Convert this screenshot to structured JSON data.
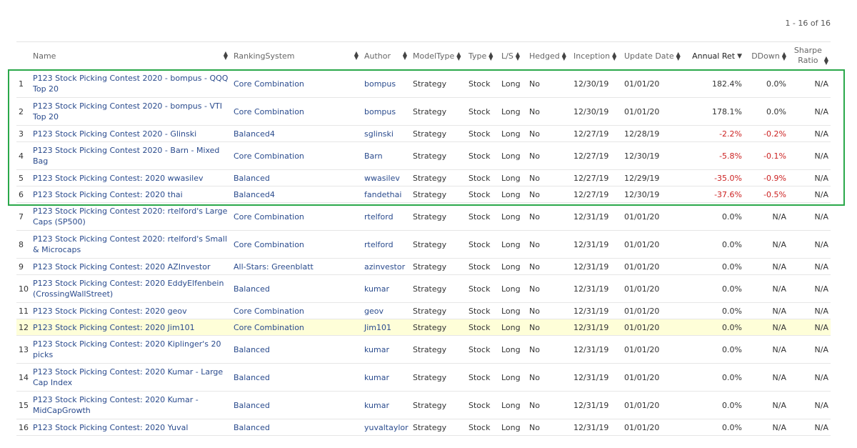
{
  "pager": {
    "text": "1 - 16 of 16"
  },
  "columns": {
    "name": "Name",
    "ranking": "RankingSystem",
    "author": "Author",
    "modeltype": "ModelType",
    "type": "Type",
    "ls": "L/S",
    "hedged": "Hedged",
    "inception": "Inception",
    "update": "Update Date",
    "annual": "Annual Ret",
    "ddown": "DDown",
    "sharpe_line1": "Sharpe",
    "sharpe_line2": "Ratio"
  },
  "rows": [
    {
      "num": "1",
      "name": "P123 Stock Picking Contest 2020 - bompus - QQQ Top 20",
      "ranking": "Core Combination",
      "author": "bompus",
      "modeltype": "Strategy",
      "type": "Stock",
      "ls": "Long",
      "hedged": "No",
      "inception": "12/30/19",
      "update": "01/01/20",
      "annual": "182.4%",
      "ddown": "0.0%",
      "sharpe": "N/A"
    },
    {
      "num": "2",
      "name": "P123 Stock Picking Contest 2020 - bompus - VTI Top 20",
      "ranking": "Core Combination",
      "author": "bompus",
      "modeltype": "Strategy",
      "type": "Stock",
      "ls": "Long",
      "hedged": "No",
      "inception": "12/30/19",
      "update": "01/01/20",
      "annual": "178.1%",
      "ddown": "0.0%",
      "sharpe": "N/A"
    },
    {
      "num": "3",
      "name": "P123 Stock Picking Contest 2020 - Glinski",
      "ranking": "Balanced4",
      "author": "sglinski",
      "modeltype": "Strategy",
      "type": "Stock",
      "ls": "Long",
      "hedged": "No",
      "inception": "12/27/19",
      "update": "12/28/19",
      "annual": "-2.2%",
      "ddown": "-0.2%",
      "sharpe": "N/A"
    },
    {
      "num": "4",
      "name": "P123 Stock Picking Contest 2020 - Barn - Mixed Bag",
      "ranking": "Core Combination",
      "author": "Barn",
      "modeltype": "Strategy",
      "type": "Stock",
      "ls": "Long",
      "hedged": "No",
      "inception": "12/27/19",
      "update": "12/30/19",
      "annual": "-5.8%",
      "ddown": "-0.1%",
      "sharpe": "N/A"
    },
    {
      "num": "5",
      "name": "P123 Stock Picking Contest: 2020 wwasilev",
      "ranking": "Balanced",
      "author": "wwasilev",
      "modeltype": "Strategy",
      "type": "Stock",
      "ls": "Long",
      "hedged": "No",
      "inception": "12/27/19",
      "update": "12/29/19",
      "annual": "-35.0%",
      "ddown": "-0.9%",
      "sharpe": "N/A"
    },
    {
      "num": "6",
      "name": "P123 Stock Picking Contest: 2020 thai",
      "ranking": "Balanced4",
      "author": "fandethai",
      "modeltype": "Strategy",
      "type": "Stock",
      "ls": "Long",
      "hedged": "No",
      "inception": "12/27/19",
      "update": "12/30/19",
      "annual": "-37.6%",
      "ddown": "-0.5%",
      "sharpe": "N/A"
    },
    {
      "num": "7",
      "name": "P123 Stock Picking Contest 2020: rtelford's Large Caps (SP500)",
      "ranking": "Core Combination",
      "author": "rtelford",
      "modeltype": "Strategy",
      "type": "Stock",
      "ls": "Long",
      "hedged": "No",
      "inception": "12/31/19",
      "update": "01/01/20",
      "annual": "0.0%",
      "ddown": "N/A",
      "sharpe": "N/A"
    },
    {
      "num": "8",
      "name": "P123 Stock Picking Contest 2020: rtelford's Small & Microcaps",
      "ranking": "Core Combination",
      "author": "rtelford",
      "modeltype": "Strategy",
      "type": "Stock",
      "ls": "Long",
      "hedged": "No",
      "inception": "12/31/19",
      "update": "01/01/20",
      "annual": "0.0%",
      "ddown": "N/A",
      "sharpe": "N/A"
    },
    {
      "num": "9",
      "name": "P123 Stock Picking Contest: 2020 AZInvestor",
      "ranking": "All-Stars: Greenblatt",
      "author": "azinvestor",
      "modeltype": "Strategy",
      "type": "Stock",
      "ls": "Long",
      "hedged": "No",
      "inception": "12/31/19",
      "update": "01/01/20",
      "annual": "0.0%",
      "ddown": "N/A",
      "sharpe": "N/A"
    },
    {
      "num": "10",
      "name": "P123 Stock Picking Contest: 2020 EddyElfenbein (CrossingWallStreet)",
      "ranking": "Balanced",
      "author": "kumar",
      "modeltype": "Strategy",
      "type": "Stock",
      "ls": "Long",
      "hedged": "No",
      "inception": "12/31/19",
      "update": "01/01/20",
      "annual": "0.0%",
      "ddown": "N/A",
      "sharpe": "N/A"
    },
    {
      "num": "11",
      "name": "P123 Stock Picking Contest: 2020 geov",
      "ranking": "Core Combination",
      "author": "geov",
      "modeltype": "Strategy",
      "type": "Stock",
      "ls": "Long",
      "hedged": "No",
      "inception": "12/31/19",
      "update": "01/01/20",
      "annual": "0.0%",
      "ddown": "N/A",
      "sharpe": "N/A"
    },
    {
      "num": "12",
      "name": "P123 Stock Picking Contest: 2020 Jim101",
      "ranking": "Core Combination",
      "author": "Jim101",
      "modeltype": "Strategy",
      "type": "Stock",
      "ls": "Long",
      "hedged": "No",
      "inception": "12/31/19",
      "update": "01/01/20",
      "annual": "0.0%",
      "ddown": "N/A",
      "sharpe": "N/A"
    },
    {
      "num": "13",
      "name": "P123 Stock Picking Contest: 2020 Kiplinger's 20 picks",
      "ranking": "Balanced",
      "author": "kumar",
      "modeltype": "Strategy",
      "type": "Stock",
      "ls": "Long",
      "hedged": "No",
      "inception": "12/31/19",
      "update": "01/01/20",
      "annual": "0.0%",
      "ddown": "N/A",
      "sharpe": "N/A"
    },
    {
      "num": "14",
      "name": "P123 Stock Picking Contest: 2020 Kumar - Large Cap Index",
      "ranking": "Balanced",
      "author": "kumar",
      "modeltype": "Strategy",
      "type": "Stock",
      "ls": "Long",
      "hedged": "No",
      "inception": "12/31/19",
      "update": "01/01/20",
      "annual": "0.0%",
      "ddown": "N/A",
      "sharpe": "N/A"
    },
    {
      "num": "15",
      "name": "P123 Stock Picking Contest: 2020 Kumar - MidCapGrowth",
      "ranking": "Balanced",
      "author": "kumar",
      "modeltype": "Strategy",
      "type": "Stock",
      "ls": "Long",
      "hedged": "No",
      "inception": "12/31/19",
      "update": "01/01/20",
      "annual": "0.0%",
      "ddown": "N/A",
      "sharpe": "N/A"
    },
    {
      "num": "16",
      "name": "P123 Stock Picking Contest: 2020 Yuval",
      "ranking": "Balanced",
      "author": "yuvaltaylor",
      "modeltype": "Strategy",
      "type": "Stock",
      "ls": "Long",
      "hedged": "No",
      "inception": "12/31/19",
      "update": "01/01/20",
      "annual": "0.0%",
      "ddown": "N/A",
      "sharpe": "N/A"
    }
  ]
}
